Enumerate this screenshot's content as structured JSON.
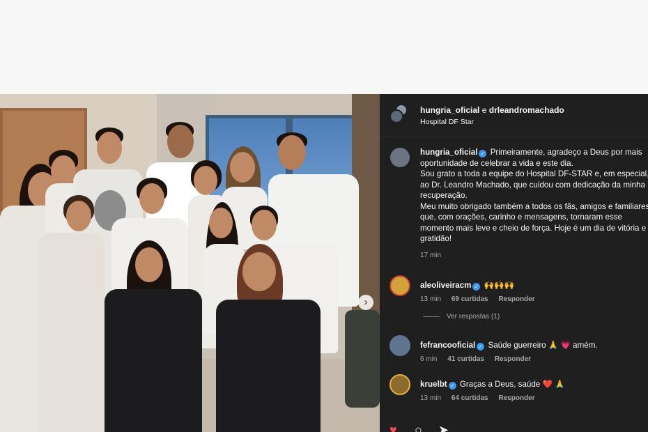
{
  "header": {
    "user1": "hungria_oficial",
    "conjunction": "e",
    "user2": "drleandromachado",
    "location": "Hospital DF Star"
  },
  "caption": {
    "user": "hungria_oficial",
    "text": "Primeiramente, agradeço a Deus por mais\noportunidade de celebrar a vida e este dia.\nSou grato a toda a equipe do Hospital DF-STAR e, em especial,\nao Dr. Leandro Machado, que cuidou com dedicação da minha\nrecuperação.\nMeu muito obrigado também a todos os fãs, amigos e familiares\nque, com orações, carinho e mensagens, tornaram esse\nmomento mais leve e cheio de força. Hoje é um dia de vitória e\ngratidão!",
    "time": "17 min"
  },
  "comments": [
    {
      "user": "aleoliveiracm",
      "text": "🙌🙌🙌",
      "time": "13 min",
      "likes": "69 curtidas",
      "reply": "Responder",
      "avatar_color": "#d4a23a"
    },
    {
      "user": "fefrancooficial",
      "text": "Saúde guerreiro 🙏 💗 amém.",
      "time": "6 min",
      "likes": "41 curtidas",
      "reply": "Responder",
      "avatar_color": "#5e7590"
    },
    {
      "user": "kruelbt",
      "text": "Graças a Deus, saúde ❤️ 🙏",
      "time": "13 min",
      "likes": "64 curtidas",
      "reply": "Responder",
      "avatar_color": "#8a6a2e"
    }
  ],
  "replies_label": "Ver respostas (1)",
  "icons": {
    "carousel_next": "chevron-right-icon",
    "like": "heart-icon",
    "comment": "comment-icon",
    "share": "send-icon"
  },
  "colors": {
    "panel_bg": "#1f1f1f",
    "verified": "#3897f0",
    "like": "#ed4956"
  }
}
